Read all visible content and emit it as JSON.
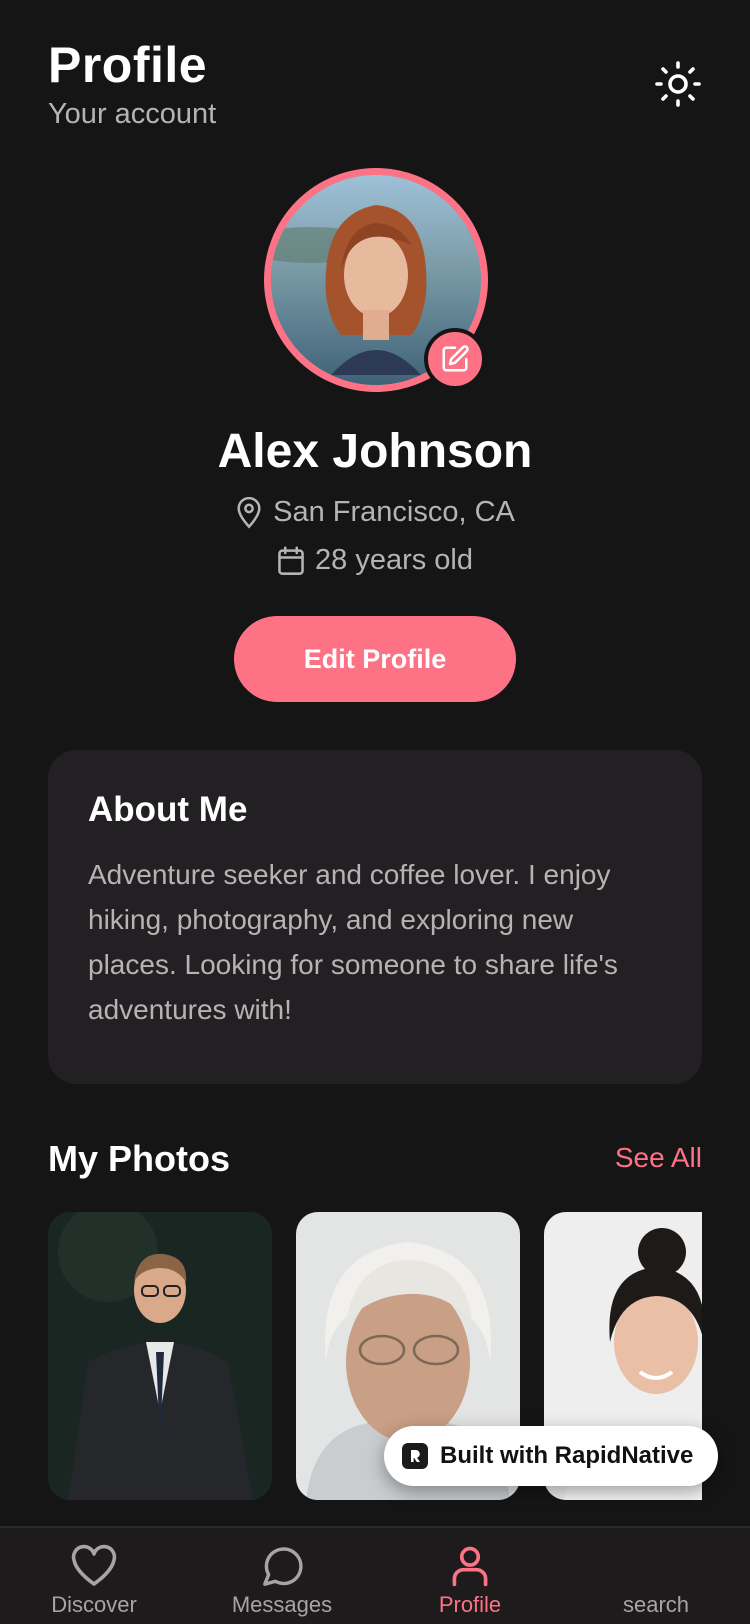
{
  "header": {
    "title": "Profile",
    "subtitle": "Your account",
    "theme_icon": "sun-icon"
  },
  "profile": {
    "name": "Alex Johnson",
    "location": "San Francisco, CA",
    "age_text": "28 years old",
    "edit_button": "Edit Profile"
  },
  "about": {
    "title": "About Me",
    "text": "Adventure seeker and coffee lover. I enjoy hiking, photography, and exploring new places. Looking for someone to share life's adventures with!"
  },
  "photos": {
    "title": "My Photos",
    "see_all": "See All"
  },
  "badge": {
    "text": "Built with RapidNative"
  },
  "nav": {
    "items": [
      {
        "label": "Discover",
        "icon": "heart-icon"
      },
      {
        "label": "Messages",
        "icon": "chat-bubble-icon"
      },
      {
        "label": "Profile",
        "icon": "user-icon",
        "active": true
      },
      {
        "label": "search",
        "icon": "search-icon"
      }
    ]
  },
  "colors": {
    "accent": "#fd7385",
    "background": "#161516",
    "card": "#222022",
    "muted_text": "#b6b3b4"
  }
}
